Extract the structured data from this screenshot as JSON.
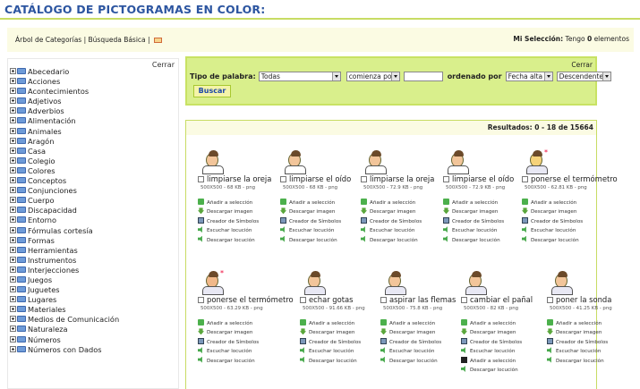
{
  "header": {
    "title": "CATÁLOGO DE PICTOGRAMAS EN COLOR:"
  },
  "toolbar": {
    "links": [
      "Árbol de Categorías",
      "Búsqueda Básica"
    ],
    "selection_label": "Mi Selección:",
    "selection_text": "Tengo",
    "selection_count": "0",
    "selection_unit": "elementos"
  },
  "sidebar": {
    "close_label": "Cerrar",
    "categories": [
      "Abecedario",
      "Acciones",
      "Acontecimientos",
      "Adjetivos",
      "Adverbios",
      "Alimentación",
      "Animales",
      "Aragón",
      "Casa",
      "Colegio",
      "Colores",
      "Conceptos",
      "Conjunciones",
      "Cuerpo",
      "Discapacidad",
      "Entorno",
      "Fórmulas cortesía",
      "Formas",
      "Herramientas",
      "Instrumentos",
      "Interjecciones",
      "Juegos",
      "Juguetes",
      "Lugares",
      "Materiales",
      "Medios de Comunicación",
      "Naturaleza",
      "Números",
      "Números con Dados"
    ]
  },
  "search": {
    "close_label": "Cerrar",
    "word_type_label": "Tipo de palabra:",
    "word_type_value": "Todas",
    "match_value": "comienza por",
    "text_value": "",
    "order_label": "ordenado por",
    "order_value": "Fecha alta",
    "direction_value": "Descendente",
    "submit_label": "Buscar"
  },
  "results": {
    "summary": "Resultados: 0 - 18 de 15664",
    "actions": {
      "add": "Añadir a selección",
      "download": "Descargar imagen",
      "creator": "Creador de Símbolos",
      "listen": "Escuchar locución",
      "download_audio": "Descargar locución"
    },
    "items": [
      {
        "name": "limpiarse la oreja",
        "meta": "500X500 - 68 KB - png"
      },
      {
        "name": "limpiarse el oído",
        "meta": "500X500 - 68 KB - png"
      },
      {
        "name": "limpiarse la oreja",
        "meta": "500X500 - 72.9 KB - png"
      },
      {
        "name": "limpiarse el oído",
        "meta": "500X500 - 72.9 KB - png"
      },
      {
        "name": "ponerse el termómetro",
        "meta": "500X500 - 62.81 KB - png"
      },
      {
        "name": "ponerse el termómetro",
        "meta": "500X500 - 63.29 KB - png"
      },
      {
        "name": "echar gotas",
        "meta": "500X500 - 91.66 KB - png"
      },
      {
        "name": "aspirar las flemas",
        "meta": "500X500 - 75.8 KB - png"
      },
      {
        "name": "cambiar el pañal",
        "meta": "500X500 - 82 KB - png"
      },
      {
        "name": "poner la sonda",
        "meta": "500X500 - 41.25 KB - png"
      }
    ]
  }
}
